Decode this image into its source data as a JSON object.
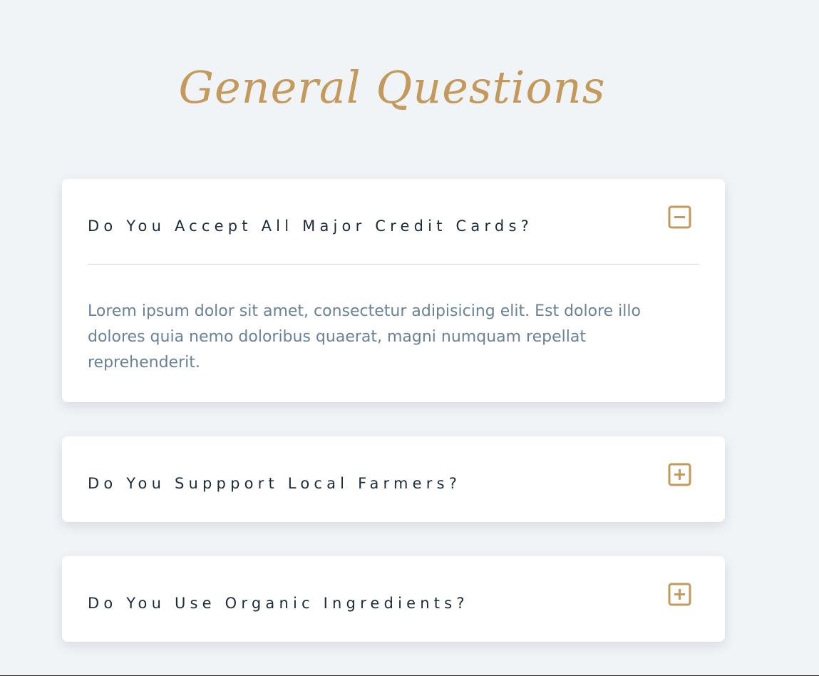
{
  "page": {
    "title": "General Questions"
  },
  "faq": {
    "items": [
      {
        "question": "Do You Accept All Major Credit Cards?",
        "answer": "Lorem ipsum dolor sit amet, consectetur adipisicing elit. Est dolore illo dolores quia nemo doloribus quaerat, magni numquam repellat reprehenderit.",
        "expanded": true,
        "toggle_icon": "minus-square-icon"
      },
      {
        "question": "Do You Suppport Local Farmers?",
        "expanded": false,
        "toggle_icon": "plus-square-icon"
      },
      {
        "question": "Do You Use Organic Ingredients?",
        "expanded": false,
        "toggle_icon": "plus-square-icon"
      }
    ]
  },
  "colors": {
    "background": "#f1f4f7",
    "accent": "#c49a5c",
    "question_text": "#1c2b3a",
    "answer_text": "#6a8299",
    "card": "#ffffff"
  }
}
